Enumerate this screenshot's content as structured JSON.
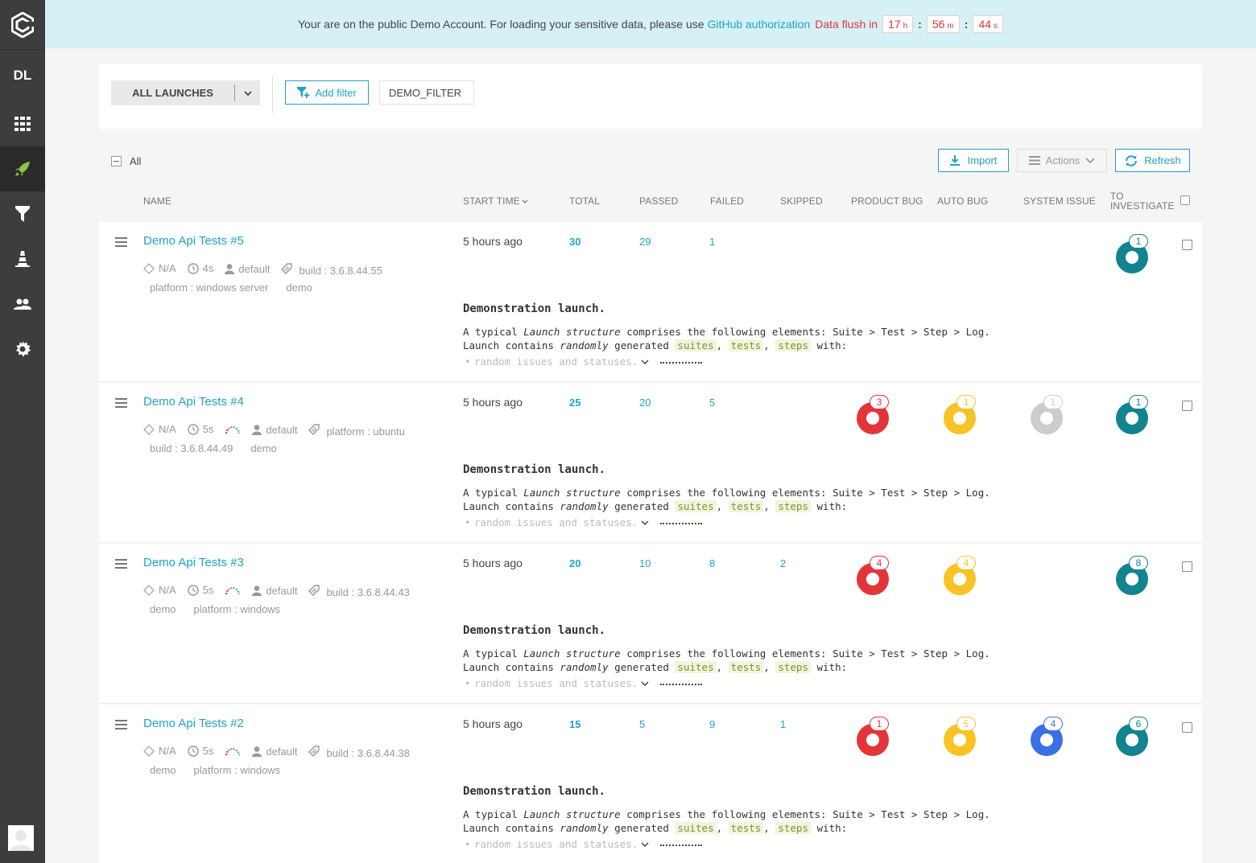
{
  "banner": {
    "message": "Your are on the public Demo Account. For loading your sensitive data, please use",
    "link": "GitHub authorization",
    "flush_label": "Data flush in",
    "hours": "17",
    "hours_unit": "h",
    "minutes": "56",
    "minutes_unit": "m",
    "seconds": "44",
    "seconds_unit": "s",
    "separator": ":"
  },
  "sidebar": {
    "project_label": "DL",
    "items": [
      "dashboard-icon",
      "launches-icon",
      "filters-icon",
      "debug-icon",
      "members-icon",
      "settings-icon"
    ]
  },
  "filterbar": {
    "all_launches": "ALL LAUNCHES",
    "add_filter": "Add filter",
    "demo_filter": "DEMO_FILTER"
  },
  "toolbar": {
    "all_label": "All",
    "import": "Import",
    "actions": "Actions",
    "refresh": "Refresh"
  },
  "columns": {
    "name": "NAME",
    "start_time": "START TIME",
    "total": "TOTAL",
    "passed": "PASSED",
    "failed": "FAILED",
    "skipped": "SKIPPED",
    "product_bug": "PRODUCT BUG",
    "auto_bug": "AUTO BUG",
    "system_issue": "SYSTEM ISSUE",
    "to_investigate_1": "TO",
    "to_investigate_2": "INVESTIGATE"
  },
  "colors": {
    "accent": "#1fa3c7",
    "product_bug": "#e3343a",
    "auto_bug": "#f7c325",
    "system_issue_gray": "#cccccc",
    "system_issue_blue": "#3a6fe6",
    "to_investigate": "#12838f"
  },
  "description": {
    "title": "Demonstration launch.",
    "line1_a": "A typical",
    "line1_em": "Launch structure",
    "line1_b": "comprises the following elements: Suite > Test > Step > Log.",
    "line2_a": "Launch contains",
    "line2_em": "randomly",
    "line2_b": "generated",
    "tag1": "suites",
    "comma": ",",
    "tag2": "tests",
    "tag3": "steps",
    "line2_c": "with:",
    "bullet": "random issues and statuses."
  },
  "launches": [
    {
      "name": "Demo Api Tests #5",
      "na": "N/A",
      "duration": "4s",
      "owner": "default",
      "attrs_line1": [
        "build : 3.6.8.44.55"
      ],
      "attrs_line2": [
        "platform : windows server",
        "demo"
      ],
      "start_time": "5 hours ago",
      "total": "30",
      "passed": "29",
      "failed": "1",
      "skipped": "",
      "product_bug": "",
      "auto_bug": "",
      "system_issue": "",
      "to_investigate": "1"
    },
    {
      "name": "Demo Api Tests #4",
      "na": "N/A",
      "duration": "5s",
      "owner": "default",
      "attrs_line1": [
        "platform : ubuntu"
      ],
      "attrs_line2": [
        "build : 3.6.8.44.49",
        "demo"
      ],
      "start_time": "5 hours ago",
      "total": "25",
      "passed": "20",
      "failed": "5",
      "skipped": "",
      "product_bug": "3",
      "auto_bug": "1",
      "system_issue": "1",
      "to_investigate": "1"
    },
    {
      "name": "Demo Api Tests #3",
      "na": "N/A",
      "duration": "5s",
      "owner": "default",
      "attrs_line1": [
        "build : 3.6.8.44.43"
      ],
      "attrs_line2": [
        "demo",
        "platform : windows"
      ],
      "start_time": "5 hours ago",
      "total": "20",
      "passed": "10",
      "failed": "8",
      "skipped": "2",
      "product_bug": "4",
      "auto_bug": "4",
      "system_issue": "",
      "to_investigate": "8"
    },
    {
      "name": "Demo Api Tests #2",
      "na": "N/A",
      "duration": "5s",
      "owner": "default",
      "attrs_line1": [
        "build : 3.6.8.44.38"
      ],
      "attrs_line2": [
        "demo",
        "platform : windows"
      ],
      "start_time": "5 hours ago",
      "total": "15",
      "passed": "5",
      "failed": "9",
      "skipped": "1",
      "product_bug": "1",
      "auto_bug": "5",
      "system_issue": "4",
      "to_investigate": "6"
    }
  ]
}
